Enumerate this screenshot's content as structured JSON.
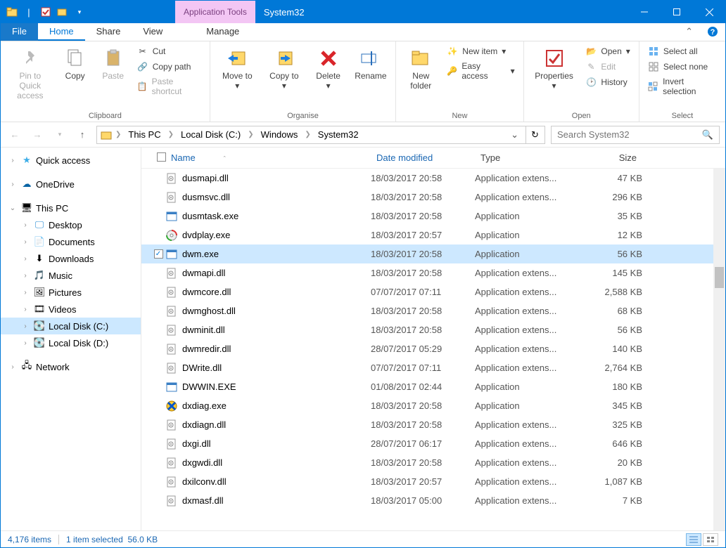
{
  "title": "System32",
  "tool_tab": "Application Tools",
  "tabs": {
    "file": "File",
    "home": "Home",
    "share": "Share",
    "view": "View",
    "manage": "Manage"
  },
  "ribbon": {
    "pin": "Pin to Quick access",
    "copy": "Copy",
    "paste": "Paste",
    "cut": "Cut",
    "copypath": "Copy path",
    "pasteshort": "Paste shortcut",
    "clipboard": "Clipboard",
    "moveto": "Move to",
    "copyto": "Copy to",
    "delete": "Delete",
    "rename": "Rename",
    "organise": "Organise",
    "newfolder": "New folder",
    "newitem": "New item",
    "easyaccess": "Easy access",
    "new": "New",
    "properties": "Properties",
    "open_lbl": "Open",
    "edit": "Edit",
    "history": "History",
    "open_grp": "Open",
    "selectall": "Select all",
    "selectnone": "Select none",
    "invert": "Invert selection",
    "select": "Select"
  },
  "breadcrumbs": [
    "This PC",
    "Local Disk (C:)",
    "Windows",
    "System32"
  ],
  "search_placeholder": "Search System32",
  "columns": {
    "name": "Name",
    "date": "Date modified",
    "type": "Type",
    "size": "Size"
  },
  "sidebar": {
    "quick": "Quick access",
    "onedrive": "OneDrive",
    "thispc": "This PC",
    "desktop": "Desktop",
    "documents": "Documents",
    "downloads": "Downloads",
    "music": "Music",
    "pictures": "Pictures",
    "videos": "Videos",
    "diskc": "Local Disk (C:)",
    "diskd": "Local Disk (D:)",
    "network": "Network"
  },
  "files": [
    {
      "name": "dusmapi.dll",
      "date": "18/03/2017 20:58",
      "type": "Application extens...",
      "size": "47 KB",
      "icon": "dll"
    },
    {
      "name": "dusmsvc.dll",
      "date": "18/03/2017 20:58",
      "type": "Application extens...",
      "size": "296 KB",
      "icon": "dll"
    },
    {
      "name": "dusmtask.exe",
      "date": "18/03/2017 20:58",
      "type": "Application",
      "size": "35 KB",
      "icon": "exe"
    },
    {
      "name": "dvdplay.exe",
      "date": "18/03/2017 20:57",
      "type": "Application",
      "size": "12 KB",
      "icon": "dvd"
    },
    {
      "name": "dwm.exe",
      "date": "18/03/2017 20:58",
      "type": "Application",
      "size": "56 KB",
      "icon": "exe",
      "selected": true
    },
    {
      "name": "dwmapi.dll",
      "date": "18/03/2017 20:58",
      "type": "Application extens...",
      "size": "145 KB",
      "icon": "dll"
    },
    {
      "name": "dwmcore.dll",
      "date": "07/07/2017 07:11",
      "type": "Application extens...",
      "size": "2,588 KB",
      "icon": "dll"
    },
    {
      "name": "dwmghost.dll",
      "date": "18/03/2017 20:58",
      "type": "Application extens...",
      "size": "68 KB",
      "icon": "dll"
    },
    {
      "name": "dwminit.dll",
      "date": "18/03/2017 20:58",
      "type": "Application extens...",
      "size": "56 KB",
      "icon": "dll"
    },
    {
      "name": "dwmredir.dll",
      "date": "28/07/2017 05:29",
      "type": "Application extens...",
      "size": "140 KB",
      "icon": "dll"
    },
    {
      "name": "DWrite.dll",
      "date": "07/07/2017 07:11",
      "type": "Application extens...",
      "size": "2,764 KB",
      "icon": "dll"
    },
    {
      "name": "DWWIN.EXE",
      "date": "01/08/2017 02:44",
      "type": "Application",
      "size": "180 KB",
      "icon": "exe"
    },
    {
      "name": "dxdiag.exe",
      "date": "18/03/2017 20:58",
      "type": "Application",
      "size": "345 KB",
      "icon": "dxdiag"
    },
    {
      "name": "dxdiagn.dll",
      "date": "18/03/2017 20:58",
      "type": "Application extens...",
      "size": "325 KB",
      "icon": "dll"
    },
    {
      "name": "dxgi.dll",
      "date": "28/07/2017 06:17",
      "type": "Application extens...",
      "size": "646 KB",
      "icon": "dll"
    },
    {
      "name": "dxgwdi.dll",
      "date": "18/03/2017 20:58",
      "type": "Application extens...",
      "size": "20 KB",
      "icon": "dll"
    },
    {
      "name": "dxilconv.dll",
      "date": "18/03/2017 20:57",
      "type": "Application extens...",
      "size": "1,087 KB",
      "icon": "dll"
    },
    {
      "name": "dxmasf.dll",
      "date": "18/03/2017 05:00",
      "type": "Application extens...",
      "size": "7 KB",
      "icon": "dll"
    }
  ],
  "status": {
    "items": "4,176 items",
    "selected": "1 item selected",
    "size": "56.0 KB"
  }
}
